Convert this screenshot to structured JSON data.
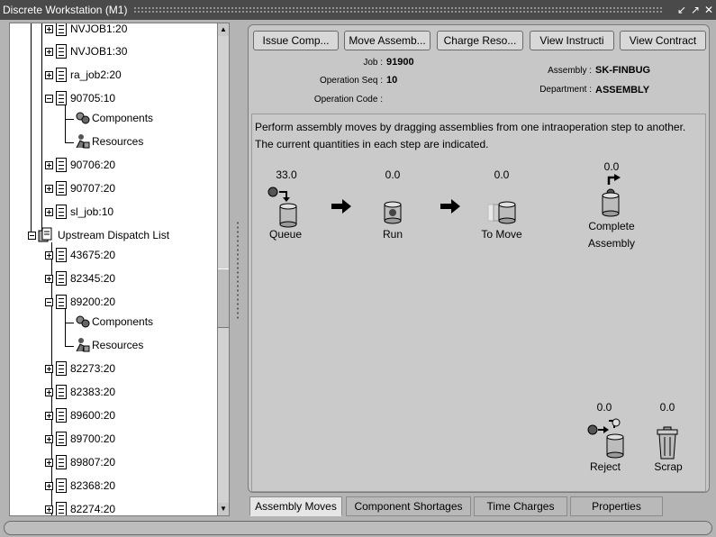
{
  "window": {
    "title": "Discrete Workstation (M1)",
    "controls": [
      "↙",
      "↗",
      "✕"
    ]
  },
  "tree": {
    "nodes": [
      {
        "label": "NVJOB1:20",
        "expanded": false,
        "icon": "doc-icon"
      },
      {
        "label": "NVJOB1:30",
        "expanded": false,
        "icon": "doc-icon"
      },
      {
        "label": "ra_job2:20",
        "expanded": false,
        "icon": "doc-icon"
      },
      {
        "label": "90705:10",
        "expanded": true,
        "icon": "doc-icon"
      },
      {
        "label": "Components",
        "icon": "components-icon"
      },
      {
        "label": "Resources",
        "icon": "resources-icon"
      },
      {
        "label": "90706:20",
        "expanded": false,
        "icon": "doc-icon"
      },
      {
        "label": "90707:20",
        "expanded": false,
        "icon": "doc-icon"
      },
      {
        "label": "sl_job:10",
        "expanded": false,
        "icon": "doc-icon"
      },
      {
        "label": "Upstream Dispatch List",
        "expanded": true,
        "icon": "folder-icon"
      },
      {
        "label": "43675:20",
        "expanded": false,
        "icon": "doc-icon"
      },
      {
        "label": "82345:20",
        "expanded": false,
        "icon": "doc-icon"
      },
      {
        "label": "89200:20",
        "expanded": true,
        "icon": "doc-icon"
      },
      {
        "label": "Components",
        "icon": "components-icon"
      },
      {
        "label": "Resources",
        "icon": "resources-icon"
      },
      {
        "label": "82273:20",
        "expanded": false,
        "icon": "doc-icon"
      },
      {
        "label": "82383:20",
        "expanded": false,
        "icon": "doc-icon"
      },
      {
        "label": "89600:20",
        "expanded": false,
        "icon": "doc-icon"
      },
      {
        "label": "89700:20",
        "expanded": false,
        "icon": "doc-icon"
      },
      {
        "label": "89807:20",
        "expanded": false,
        "icon": "doc-icon"
      },
      {
        "label": "82368:20",
        "expanded": false,
        "icon": "doc-icon"
      },
      {
        "label": "82274:20",
        "expanded": false,
        "icon": "doc-icon"
      }
    ]
  },
  "toolbar": {
    "issue_comp": "Issue Comp...",
    "move_assemb": "Move Assemb...",
    "charge_reso": "Charge Reso...",
    "view_instructi": "View Instructi",
    "view_contract": "View Contract"
  },
  "header": {
    "job_label": "Job :",
    "job_value": "91900",
    "opseq_label": "Operation Seq :",
    "opseq_value": "10",
    "opcode_label": "Operation Code :",
    "opcode_value": "",
    "assembly_label": "Assembly :",
    "assembly_value": "SK-FINBUG",
    "department_label": "Department :",
    "department_value": "ASSEMBLY"
  },
  "moves": {
    "instruction_line1": "Perform assembly moves by dragging assemblies from one intraoperation step to another.",
    "instruction_line2": "The current quantities in each step are indicated.",
    "queue": {
      "qty": "33.0",
      "label": "Queue"
    },
    "run": {
      "qty": "0.0",
      "label": "Run"
    },
    "to_move": {
      "qty": "0.0",
      "label": "To Move"
    },
    "complete": {
      "qty": "0.0",
      "label_line1": "Complete",
      "label_line2": "Assembly"
    },
    "reject": {
      "qty": "0.0",
      "label": "Reject"
    },
    "scrap": {
      "qty": "0.0",
      "label": "Scrap"
    }
  },
  "tabs": {
    "assembly_moves": "Assembly Moves",
    "component_shortages": "Component Shortages",
    "time_charges": "Time Charges",
    "properties": "Properties"
  }
}
